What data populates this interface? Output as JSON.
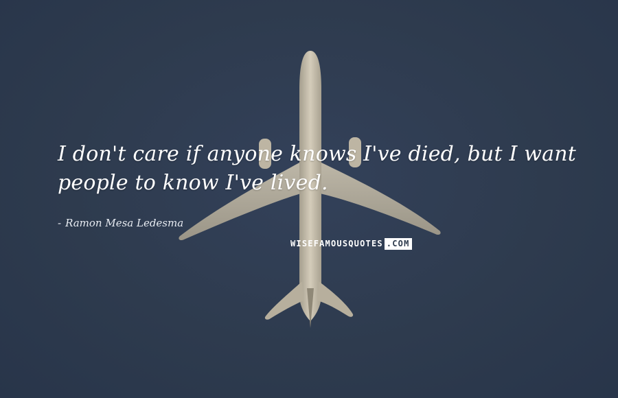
{
  "background": {
    "sky_color": "#2d3a4c",
    "subject": "airplane-silhouette",
    "plane_color": "#c8c0ae"
  },
  "quote": {
    "text": "I don't care if anyone knows I've died, but I want people to know I've lived."
  },
  "author": {
    "dash": "-",
    "name": "Ramon Mesa Ledesma"
  },
  "watermark": {
    "main": "WISEFAMOUSQUOTES",
    "tail": ".COM"
  }
}
